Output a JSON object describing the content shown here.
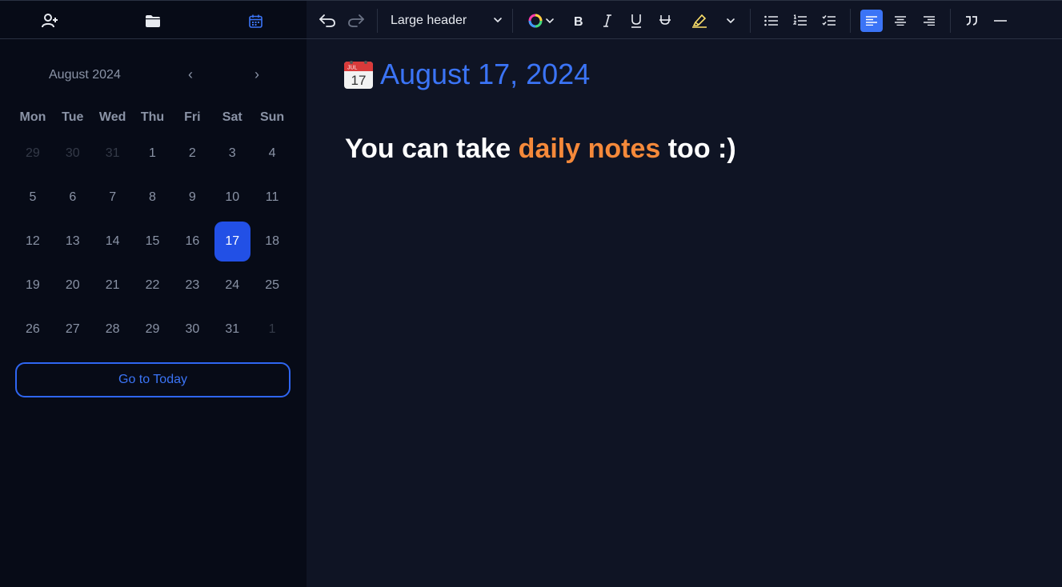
{
  "sidebar": {
    "tabs": [
      {
        "name": "contacts",
        "icon": "person-add-icon"
      },
      {
        "name": "files",
        "icon": "folder-icon"
      },
      {
        "name": "calendar",
        "icon": "calendar-icon",
        "active": true
      }
    ],
    "calendar": {
      "month_label": "August 2024",
      "prev": "‹",
      "next": "›",
      "weekdays": [
        "Mon",
        "Tue",
        "Wed",
        "Thu",
        "Fri",
        "Sat",
        "Sun"
      ],
      "days": [
        {
          "d": "29",
          "muted": true
        },
        {
          "d": "30",
          "muted": true
        },
        {
          "d": "31",
          "muted": true
        },
        {
          "d": "1"
        },
        {
          "d": "2"
        },
        {
          "d": "3"
        },
        {
          "d": "4"
        },
        {
          "d": "5"
        },
        {
          "d": "6"
        },
        {
          "d": "7"
        },
        {
          "d": "8"
        },
        {
          "d": "9"
        },
        {
          "d": "10"
        },
        {
          "d": "11"
        },
        {
          "d": "12"
        },
        {
          "d": "13"
        },
        {
          "d": "14"
        },
        {
          "d": "15"
        },
        {
          "d": "16"
        },
        {
          "d": "17",
          "selected": true
        },
        {
          "d": "18"
        },
        {
          "d": "19"
        },
        {
          "d": "20"
        },
        {
          "d": "21"
        },
        {
          "d": "22"
        },
        {
          "d": "23"
        },
        {
          "d": "24"
        },
        {
          "d": "25"
        },
        {
          "d": "26"
        },
        {
          "d": "27"
        },
        {
          "d": "28"
        },
        {
          "d": "29"
        },
        {
          "d": "30"
        },
        {
          "d": "31"
        },
        {
          "d": "1",
          "muted": true
        }
      ],
      "today_button": "Go to Today"
    }
  },
  "toolbar": {
    "block_type": "Large header",
    "items": [
      "undo-icon",
      "redo-icon",
      "text-color-icon",
      "bold-icon",
      "italic-icon",
      "underline-icon",
      "strikethrough-icon",
      "highlight-icon",
      "bullet-list-icon",
      "numbered-list-icon",
      "checklist-icon",
      "align-left-icon",
      "align-center-icon",
      "align-right-icon",
      "quote-icon",
      "divider-icon"
    ],
    "active_align": "left"
  },
  "editor": {
    "calendar_emoji_month": "JUL",
    "calendar_emoji_day": "17",
    "date_title": "August 17, 2024",
    "note": {
      "before": "You can take ",
      "highlight": "daily notes",
      "after": " too :)"
    }
  },
  "colors": {
    "accent": "#3b74f6",
    "selected_day": "#2250e6",
    "highlight_text": "#f5893a",
    "sidebar_bg": "#070b17",
    "editor_bg": "#0f1424"
  }
}
